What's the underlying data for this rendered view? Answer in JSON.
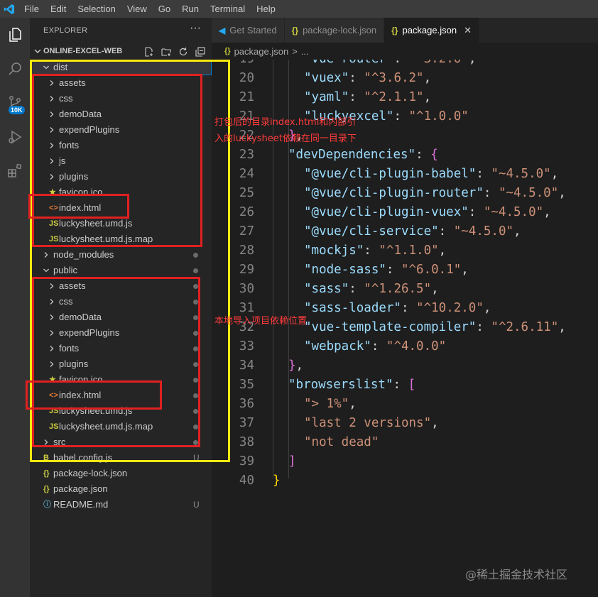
{
  "menu": [
    "File",
    "Edit",
    "Selection",
    "View",
    "Go",
    "Run",
    "Terminal",
    "Help"
  ],
  "activity_bar": {
    "items": [
      "explorer-icon",
      "search-icon",
      "source-control-icon",
      "run-debug-icon",
      "extensions-icon"
    ],
    "badge": "10K"
  },
  "sidebar": {
    "title": "EXPLORER",
    "more": "···",
    "project": "ONLINE-EXCEL-WEB",
    "tree": [
      {
        "label": "dist",
        "type": "folder",
        "expanded": true,
        "depth": 0,
        "selected": true
      },
      {
        "label": "assets",
        "type": "folder",
        "expanded": false,
        "depth": 1
      },
      {
        "label": "css",
        "type": "folder",
        "expanded": false,
        "depth": 1
      },
      {
        "label": "demoData",
        "type": "folder",
        "expanded": false,
        "depth": 1
      },
      {
        "label": "expendPlugins",
        "type": "folder",
        "expanded": false,
        "depth": 1
      },
      {
        "label": "fonts",
        "type": "folder",
        "expanded": false,
        "depth": 1
      },
      {
        "label": "js",
        "type": "folder",
        "expanded": false,
        "depth": 1
      },
      {
        "label": "plugins",
        "type": "folder",
        "expanded": false,
        "depth": 1
      },
      {
        "label": "favicon.ico",
        "type": "ico",
        "depth": 1
      },
      {
        "label": "index.html",
        "type": "html",
        "depth": 1
      },
      {
        "label": "luckysheet.umd.js",
        "type": "js",
        "depth": 1
      },
      {
        "label": "luckysheet.umd.js.map",
        "type": "js",
        "depth": 1
      },
      {
        "label": "node_modules",
        "type": "folder",
        "expanded": false,
        "depth": 0,
        "dot": true
      },
      {
        "label": "public",
        "type": "folder",
        "expanded": true,
        "depth": 0,
        "dot": true
      },
      {
        "label": "assets",
        "type": "folder",
        "expanded": false,
        "depth": 1,
        "dot": true
      },
      {
        "label": "css",
        "type": "folder",
        "expanded": false,
        "depth": 1,
        "dot": true
      },
      {
        "label": "demoData",
        "type": "folder",
        "expanded": false,
        "depth": 1,
        "dot": true
      },
      {
        "label": "expendPlugins",
        "type": "folder",
        "expanded": false,
        "depth": 1,
        "dot": true
      },
      {
        "label": "fonts",
        "type": "folder",
        "expanded": false,
        "depth": 1,
        "dot": true
      },
      {
        "label": "plugins",
        "type": "folder",
        "expanded": false,
        "depth": 1,
        "dot": true
      },
      {
        "label": "favicon.ico",
        "type": "ico",
        "depth": 1,
        "dot": true
      },
      {
        "label": "index.html",
        "type": "html",
        "depth": 1,
        "dot": true
      },
      {
        "label": "luckysheet.umd.js",
        "type": "js",
        "depth": 1,
        "dot": true
      },
      {
        "label": "luckysheet.umd.js.map",
        "type": "js",
        "depth": 1,
        "dot": true
      },
      {
        "label": "src",
        "type": "folder",
        "expanded": false,
        "depth": 0,
        "dot": true
      },
      {
        "label": "babel.config.js",
        "type": "babel",
        "depth": 0,
        "status": "U"
      },
      {
        "label": "package-lock.json",
        "type": "json",
        "depth": 0
      },
      {
        "label": "package.json",
        "type": "json",
        "depth": 0
      },
      {
        "label": "README.md",
        "type": "md",
        "depth": 0,
        "status": "U"
      }
    ]
  },
  "tabs": [
    {
      "label": "Get Started",
      "icon": "vscode",
      "active": false
    },
    {
      "label": "package-lock.json",
      "icon": "json",
      "active": false
    },
    {
      "label": "package.json",
      "icon": "json",
      "active": true,
      "close": "✕"
    }
  ],
  "breadcrumb": {
    "icon": "{}",
    "file": "package.json",
    "sep": ">",
    "more": "..."
  },
  "code_lines": [
    {
      "n": "19",
      "indent": 2,
      "key": "vue-router",
      "val": "^3.2.0",
      "comma": true
    },
    {
      "n": "20",
      "indent": 2,
      "key": "vuex",
      "val": "^3.6.2",
      "comma": true
    },
    {
      "n": "21",
      "indent": 2,
      "key": "yaml",
      "val": "^2.1.1",
      "comma": true
    },
    {
      "n": "21",
      "indent": 2,
      "key": "luckyexcel",
      "val": "^1.0.0",
      "comma": false
    },
    {
      "n": "22",
      "indent": 1,
      "close": "}",
      "comma": true
    },
    {
      "n": "23",
      "indent": 1,
      "key": "devDependencies",
      "open": "{"
    },
    {
      "n": "24",
      "indent": 2,
      "key": "@vue/cli-plugin-babel",
      "val": "~4.5.0",
      "comma": true
    },
    {
      "n": "25",
      "indent": 2,
      "key": "@vue/cli-plugin-router",
      "val": "~4.5.0",
      "comma": true
    },
    {
      "n": "26",
      "indent": 2,
      "key": "@vue/cli-plugin-vuex",
      "val": "~4.5.0",
      "comma": true
    },
    {
      "n": "27",
      "indent": 2,
      "key": "@vue/cli-service",
      "val": "~4.5.0",
      "comma": true
    },
    {
      "n": "28",
      "indent": 2,
      "key": "mockjs",
      "val": "^1.1.0",
      "comma": true
    },
    {
      "n": "29",
      "indent": 2,
      "key": "node-sass",
      "val": "^6.0.1",
      "comma": true
    },
    {
      "n": "30",
      "indent": 2,
      "key": "sass",
      "val": "^1.26.5",
      "comma": true
    },
    {
      "n": "31",
      "indent": 2,
      "key": "sass-loader",
      "val": "^10.2.0",
      "comma": true
    },
    {
      "n": "32",
      "indent": 2,
      "key": "vue-template-compiler",
      "val": "^2.6.11",
      "comma": true
    },
    {
      "n": "33",
      "indent": 2,
      "key": "webpack",
      "val": "^4.0.0",
      "comma": false
    },
    {
      "n": "34",
      "indent": 1,
      "close": "}",
      "comma": true
    },
    {
      "n": "35",
      "indent": 1,
      "key": "browserslist",
      "open": "["
    },
    {
      "n": "36",
      "indent": 2,
      "str": "> 1%",
      "comma": true
    },
    {
      "n": "37",
      "indent": 2,
      "str": "last 2 versions",
      "comma": true
    },
    {
      "n": "38",
      "indent": 2,
      "str": "not dead",
      "comma": false
    },
    {
      "n": "39",
      "indent": 1,
      "closeArr": "]"
    },
    {
      "n": "40",
      "indent": 0,
      "closeRoot": "}"
    }
  ],
  "annotations": {
    "dist_note_line1": "打包后的目录index.html和内部引",
    "dist_note_line2": "入的luckysheet依赖在同一目录下",
    "public_note": "本地导入项目依赖位置"
  },
  "watermark": "@稀土掘金技术社区",
  "colors": {
    "yellow_box": "#f6e80f",
    "red_box": "#e02020",
    "annotation_text": "#ff3b3b",
    "accent": "#007acc"
  }
}
